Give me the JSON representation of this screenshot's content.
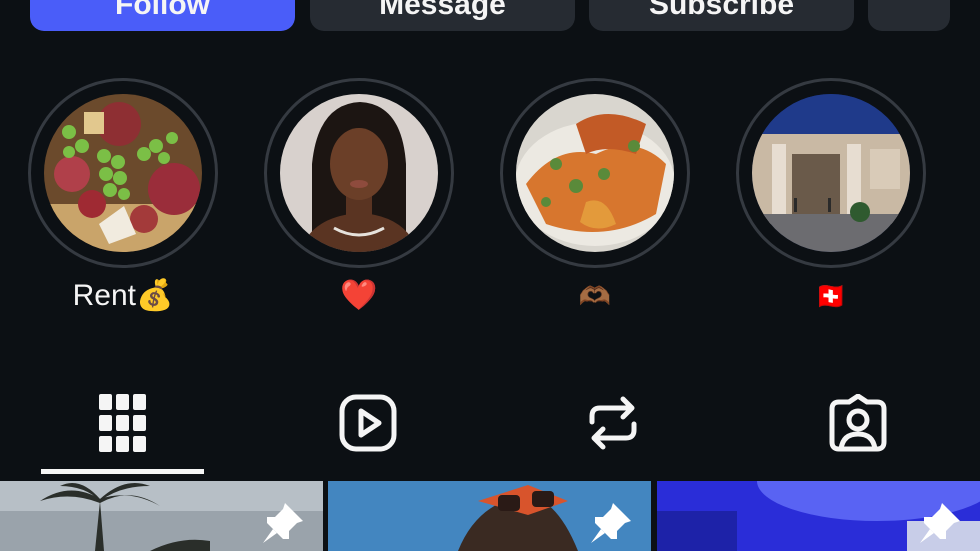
{
  "actions": {
    "follow_label": "Follow",
    "message_label": "Message",
    "subscribe_label": "Subscribe"
  },
  "highlights": [
    {
      "label": "Rent💰"
    },
    {
      "label": "❤️"
    },
    {
      "label": "🫶🏾"
    },
    {
      "label": "🇨🇭"
    }
  ],
  "tabs": [
    {
      "icon": "grid-icon",
      "active": true
    },
    {
      "icon": "reels-icon",
      "active": false
    },
    {
      "icon": "reposts-icon",
      "active": false
    },
    {
      "icon": "tagged-icon",
      "active": false
    }
  ],
  "grid": [
    {
      "icon": "pin-icon"
    },
    {
      "icon": "pin-icon"
    },
    {
      "icon": "pin-icon"
    }
  ],
  "colors": {
    "background": "#0c1014",
    "follow_button": "#4a5df9",
    "secondary_button": "#262b32",
    "ring": "#353a41",
    "text": "#f5f5f5"
  }
}
